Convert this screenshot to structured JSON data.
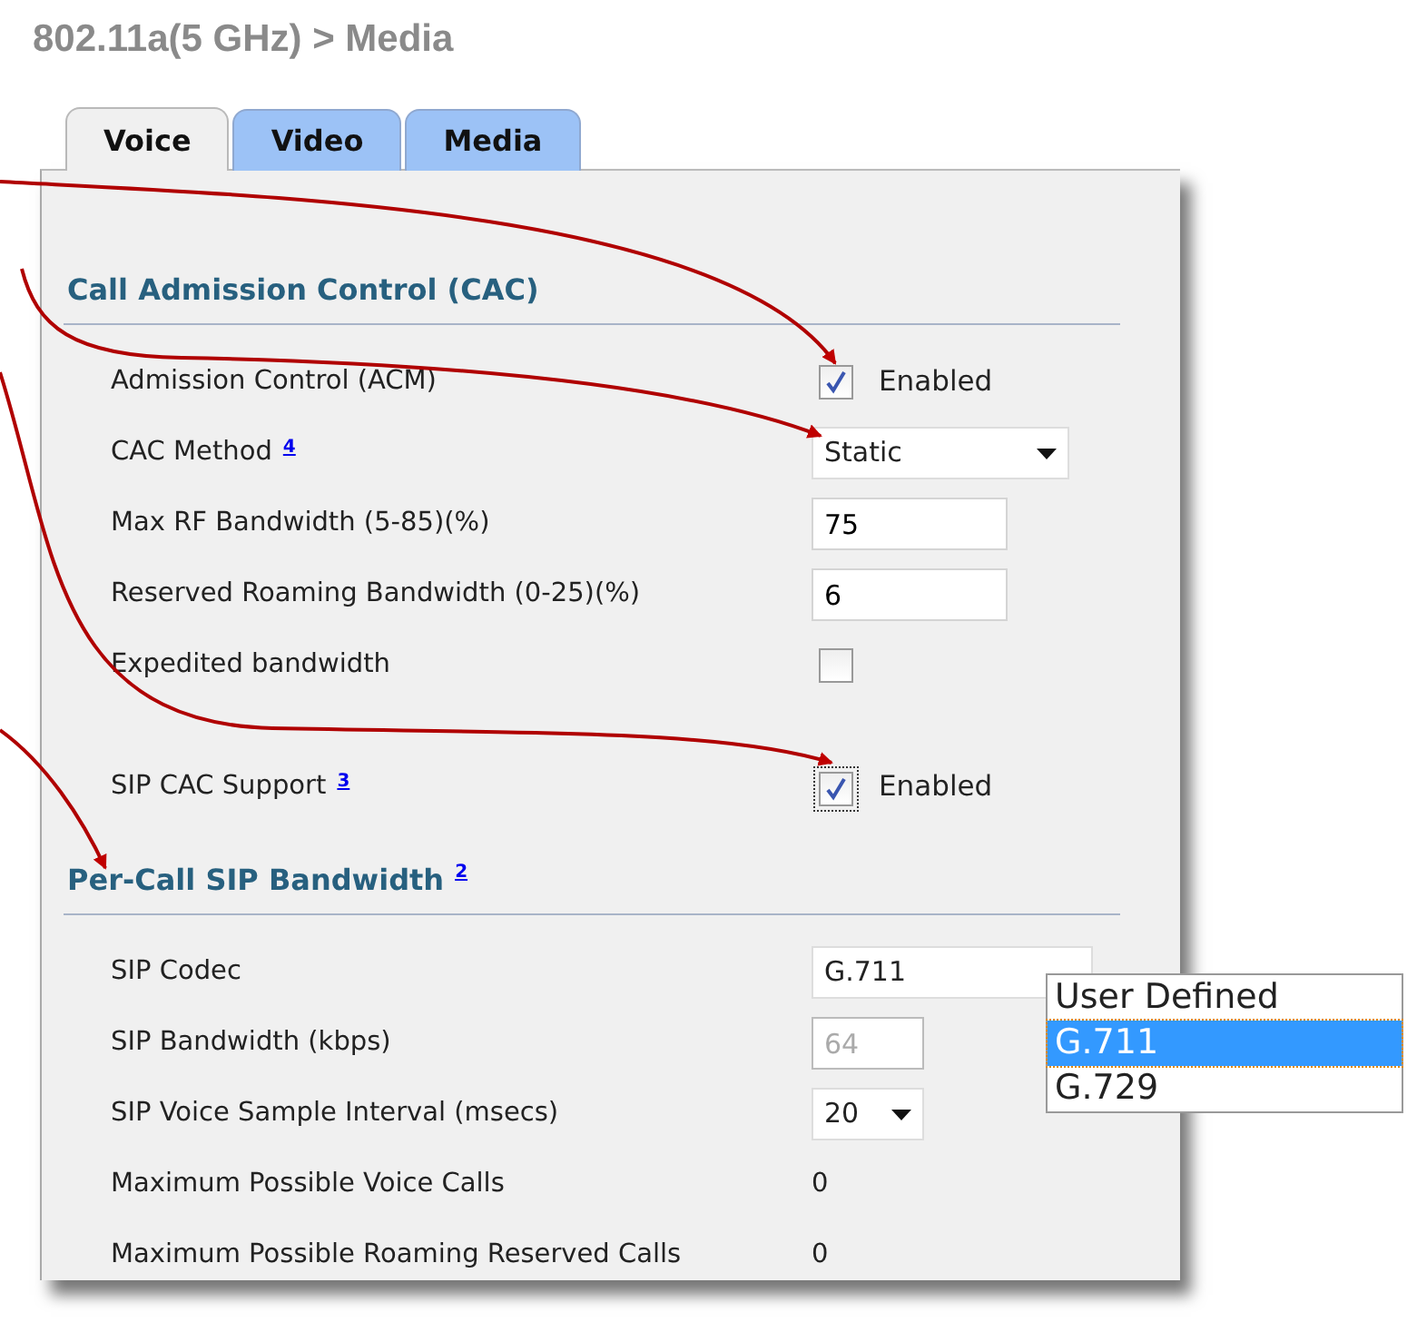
{
  "title": "802.11a(5 GHz) > Media",
  "tabs": [
    {
      "label": "Voice",
      "selected": true
    },
    {
      "label": "Video",
      "selected": false
    },
    {
      "label": "Media",
      "selected": false
    }
  ],
  "sections": [
    {
      "heading": "Call Admission Control (CAC)",
      "rows": [
        {
          "kind": "checkbox",
          "label": "Admission Control (ACM)",
          "checked": true,
          "text": "Enabled"
        },
        {
          "kind": "select",
          "label": "CAC Method",
          "footnote": "4",
          "value": "Static"
        },
        {
          "kind": "input",
          "label": "Max RF Bandwidth (5-85)(%)",
          "value": "75"
        },
        {
          "kind": "input",
          "label": "Reserved Roaming Bandwidth (0-25)(%)",
          "value": "6"
        },
        {
          "kind": "checkbox",
          "label": "Expedited bandwidth",
          "checked": false
        },
        {
          "kind": "checkbox",
          "label": "SIP CAC Support",
          "footnote": "3",
          "checked": true,
          "focused": true,
          "text": "Enabled"
        }
      ]
    },
    {
      "heading": "Per-Call SIP Bandwidth",
      "footnote": "2",
      "rows": [
        {
          "kind": "select",
          "label": "SIP Codec",
          "value": "G.711",
          "options": [
            {
              "label": "User Defined",
              "selected": false
            },
            {
              "label": "G.711",
              "selected": true
            },
            {
              "label": "G.729",
              "selected": false
            }
          ]
        },
        {
          "kind": "input",
          "label": "SIP Bandwidth (kbps)",
          "value": "64",
          "disabled": true
        },
        {
          "kind": "select",
          "label": "SIP Voice Sample Interval (msecs)",
          "value": "20"
        },
        {
          "kind": "text",
          "label": "Maximum Possible Voice Calls",
          "value": "0"
        },
        {
          "kind": "text",
          "label": "Maximum Possible Roaming Reserved Calls",
          "value": "0"
        }
      ]
    }
  ]
}
